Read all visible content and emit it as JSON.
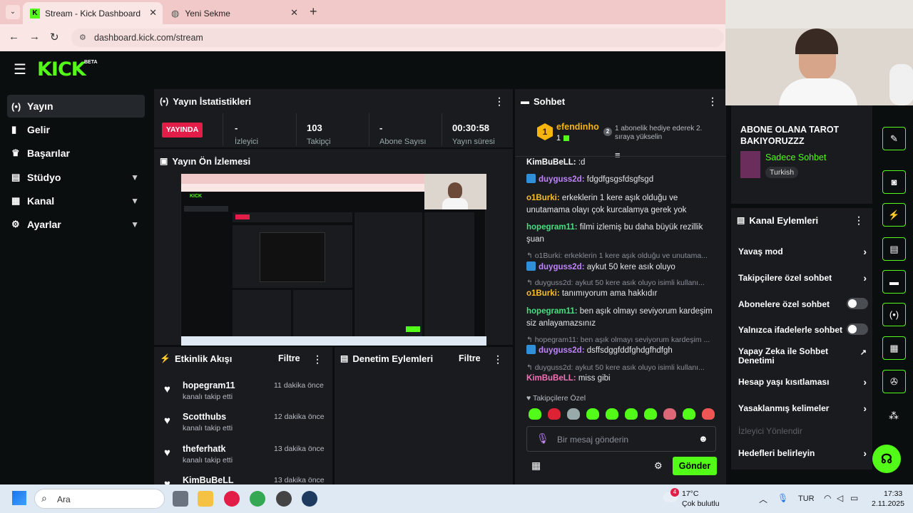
{
  "browser": {
    "tabs": [
      {
        "title": "Stream - Kick Dashboard",
        "active": true
      },
      {
        "title": "Yeni Sekme",
        "active": false
      }
    ],
    "url": "dashboard.kick.com/stream",
    "new_tab_label": "+",
    "close_label": "✕"
  },
  "logo": {
    "text": "KICK",
    "beta": "BETA"
  },
  "sidebar": {
    "items": [
      {
        "label": "Yayın",
        "icon": "broadcast-icon",
        "glyph": "(•)"
      },
      {
        "label": "Gelir",
        "icon": "chart-icon",
        "glyph": "▮"
      },
      {
        "label": "Başarılar",
        "icon": "trophy-icon",
        "glyph": "♛"
      },
      {
        "label": "Stüdyo",
        "icon": "studio-icon",
        "glyph": "▤"
      },
      {
        "label": "Kanal",
        "icon": "channel-icon",
        "glyph": "▦"
      },
      {
        "label": "Ayarlar",
        "icon": "gear-icon",
        "glyph": "⚙"
      }
    ]
  },
  "stats": {
    "title": "Yayın İstatistikleri",
    "status": "YAYINDA",
    "values": [
      "-",
      "103",
      "-",
      "00:30:58"
    ],
    "labels": [
      "İzleyici",
      "Takipçi",
      "Abone Sayısı",
      "Yayın süresi"
    ]
  },
  "preview": {
    "title": "Yayın Ön İzlemesi"
  },
  "events": {
    "title": "Etkinlik Akışı",
    "filter": "Filtre",
    "items": [
      {
        "name": "hopegram11",
        "action": "kanalı takip etti",
        "time": "11 dakika önce"
      },
      {
        "name": "Scotthubs",
        "action": "kanalı takip etti",
        "time": "12 dakika önce"
      },
      {
        "name": "theferhatk",
        "action": "kanalı takip etti",
        "time": "13 dakika önce"
      },
      {
        "name": "KimBuBeLL",
        "action": "",
        "time": "13 dakika önce"
      }
    ]
  },
  "moderation": {
    "title": "Denetim Eylemleri",
    "filter": "Filtre"
  },
  "chat": {
    "title": "Sohbet",
    "pinned_user": "efendinho",
    "pinned_count": "1",
    "pinned_rank": "1",
    "gift_rank": "2",
    "gift_text": "1 abonelik hediye ederek 2. sıraya yükselin",
    "messages": [
      {
        "kind": "msg",
        "user": "KimBuBeLL:",
        "text": ":d",
        "color": "#4ade80",
        "badge": false
      },
      {
        "kind": "msg",
        "user": "duyguss2d:",
        "text": "fdgdfgsgsfdsgfsgd",
        "color": "#c084fc",
        "badge": true
      },
      {
        "kind": "msg",
        "user": "o1Burki:",
        "text": "erkeklerin 1 kere aşık olduğu ve unutamama olayı çok kurcalamya gerek yok",
        "color": "#fbbf24",
        "badge": false
      },
      {
        "kind": "msg",
        "user": "hopegram11:",
        "text": "filmi izlemiş bu daha büyük rezillik şuan",
        "color": "#4ade80",
        "badge": false
      },
      {
        "kind": "reply",
        "text": "o1Burki: erkeklerin 1 kere aşık olduğu ve unutama..."
      },
      {
        "kind": "msg",
        "user": "duyguss2d:",
        "text": "aykut 50 kere asık oluyo",
        "color": "#c084fc",
        "badge": true
      },
      {
        "kind": "reply",
        "text": "duyguss2d: aykut 50 kere asık oluyo isimli kullanı..."
      },
      {
        "kind": "msg",
        "user": "o1Burki:",
        "text": "tanımıyorum ama hakkıdır",
        "color": "#fbbf24",
        "badge": false
      },
      {
        "kind": "msg",
        "user": "hopegram11:",
        "text": "ben aşık olmayı seviyorum kardeşim siz anlayamazsınız",
        "color": "#4ade80",
        "badge": false
      },
      {
        "kind": "reply",
        "text": "hopegram11: ben aşık olmayı seviyorum kardeşim ..."
      },
      {
        "kind": "msg",
        "user": "duyguss2d:",
        "text": "dsffsdggfddfghdgfhdfgh",
        "color": "#c084fc",
        "badge": true
      },
      {
        "kind": "reply",
        "text": "duyguss2d: aykut 50 kere asık oluyo isimli kullanı..."
      },
      {
        "kind": "msg",
        "user": "KimBuBeLL:",
        "text": "miss gibi",
        "color": "#f472b6",
        "badge": false
      }
    ],
    "followers_only": "Takipçilere Özel",
    "input_placeholder": "Bir mesaj gönderin",
    "send": "Gönder"
  },
  "stream_info": {
    "title": "ABONE OLANA TAROT BAKIYORUZZZ",
    "category": "Sadece Sohbet",
    "tag": "Turkish"
  },
  "channel_actions": {
    "title": "Kanal Eylemleri",
    "items": [
      {
        "label": "Yavaş mod",
        "control": "chevron"
      },
      {
        "label": "Takipçilere özel sohbet",
        "control": "chevron"
      },
      {
        "label": "Abonelere özel sohbet",
        "control": "toggle"
      },
      {
        "label": "Yalnızca ifadelerle sohbet",
        "control": "toggle"
      },
      {
        "label": "Yapay Zeka ile Sohbet Denetimi",
        "control": "external"
      },
      {
        "label": "Hesap yaşı kısıtlaması",
        "control": "chevron"
      },
      {
        "label": "Yasaklanmış kelimeler",
        "control": "chevron"
      },
      {
        "label": "İzleyici Yönlendir",
        "control": "none"
      },
      {
        "label": "Hedefleri belirleyin",
        "control": "chevron"
      }
    ]
  },
  "taskbar": {
    "search": "Ara",
    "weather_temp": "17°C",
    "weather_text": "Çok bulutlu",
    "weather_badge": "4",
    "lang": "TUR",
    "time": "17:33",
    "date": "2.11.2025"
  },
  "colors": {
    "accent": "#53fc18",
    "live": "#e11d48",
    "panel": "#191b1f"
  }
}
